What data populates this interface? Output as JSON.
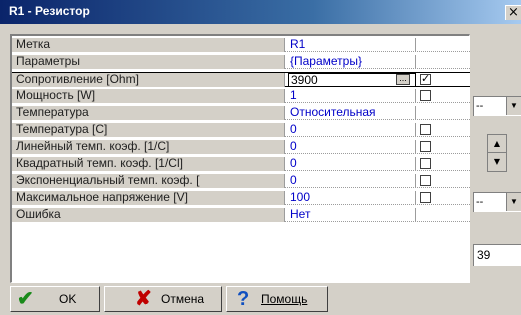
{
  "window": {
    "title": "R1 - Резистор",
    "close_glyph": "×"
  },
  "grid": {
    "rows": [
      {
        "name": "Метка",
        "value": "R1",
        "has_check": false,
        "checked": false
      },
      {
        "name": "Параметры",
        "value": "{Параметры}",
        "has_check": false,
        "checked": false
      },
      {
        "name": "Сопротивление [Ohm]",
        "value": "3900",
        "has_check": true,
        "checked": true,
        "active": true,
        "has_ellipsis": true
      },
      {
        "name": "Мощность      [W]",
        "value": "1",
        "has_check": true,
        "checked": false
      },
      {
        "name": "Температура",
        "value": "Относительная",
        "has_check": false,
        "checked": false
      },
      {
        "name": "Температура [C]",
        "value": "0",
        "has_check": true,
        "checked": false
      },
      {
        "name": "Линейный темп. коэф. [1/C]",
        "value": "0",
        "has_check": true,
        "checked": false
      },
      {
        "name": "Квадратный темп. коэф. [1/Cl]",
        "value": "0",
        "has_check": true,
        "checked": false
      },
      {
        "name": "Экспоненциальный темп. коэф. [",
        "value": "0",
        "has_check": true,
        "checked": false
      },
      {
        "name": "Максимальное напряжение [V]",
        "value": "100",
        "has_check": true,
        "checked": false
      },
      {
        "name": "Ошибка",
        "value": "Нет",
        "has_check": false,
        "checked": false
      }
    ],
    "ellipsis_glyph": "..."
  },
  "right_panel": {
    "dropdown1_value": "--",
    "dropdown2_value": "--",
    "number_value": "39",
    "arrow_down": "▼",
    "arrow_up": "▲"
  },
  "buttons": {
    "ok": {
      "label": "OK",
      "icon": "check-icon",
      "icon_glyph": "✔",
      "icon_color": "#1a8a1a"
    },
    "cancel": {
      "label": "Отмена",
      "icon": "cross-icon",
      "icon_glyph": "✘",
      "icon_color": "#c00000"
    },
    "help": {
      "label": "Помощь",
      "icon": "question-icon",
      "icon_glyph": "?",
      "icon_color": "#1050c0"
    }
  }
}
